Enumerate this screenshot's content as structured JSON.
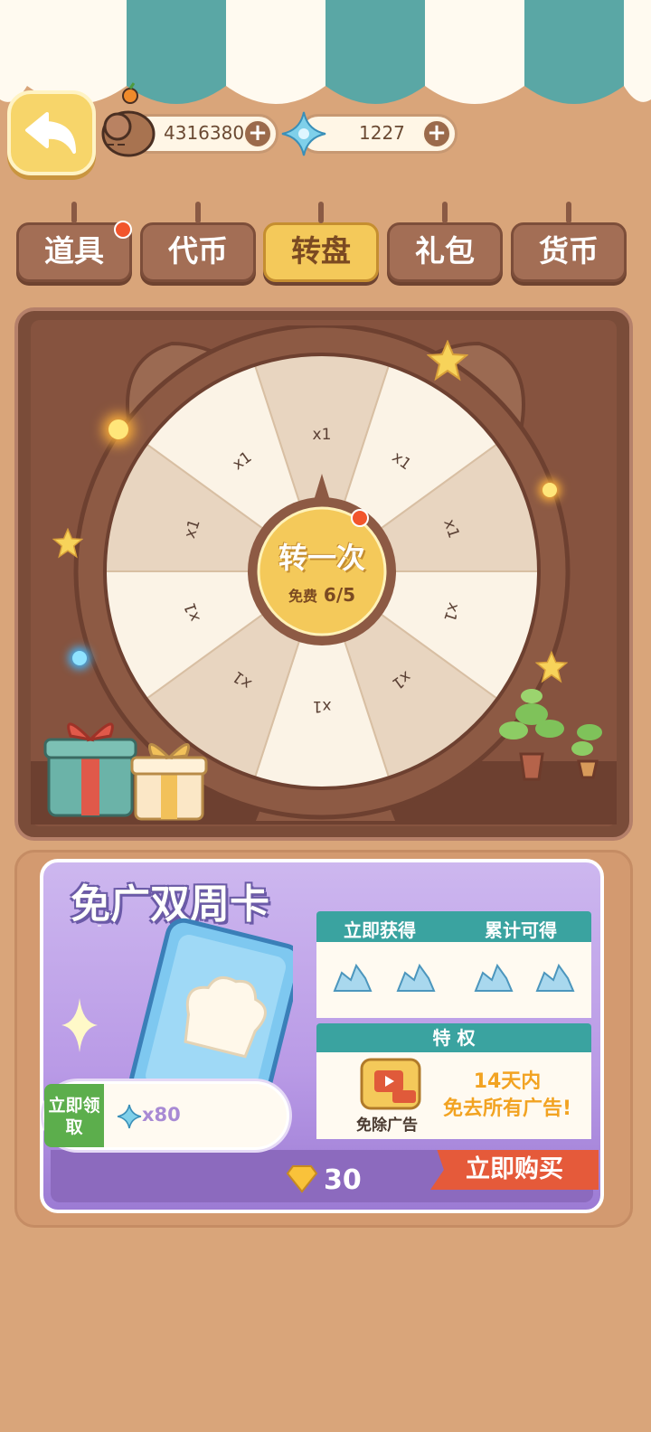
{
  "header": {
    "coins": "4316380",
    "gems": "1227"
  },
  "tabs": [
    {
      "label": "道具"
    },
    {
      "label": "代币"
    },
    {
      "label": "转盘"
    },
    {
      "label": "礼包"
    },
    {
      "label": "货币"
    }
  ],
  "wheel": {
    "segments": [
      "x1",
      "x1",
      "x1",
      "x1",
      "x1",
      "x1",
      "x1",
      "x1",
      "x1",
      "x1"
    ],
    "spin_label": "转一次",
    "free_label": "免费",
    "free_count": "6/5"
  },
  "offer": {
    "title": "免广双周卡",
    "instant_header": "立即获得",
    "total_header": "累计可得",
    "privilege_header": "特 权",
    "remove_ads_label": "免除广告",
    "privilege_text_line1": "14天内",
    "privilege_text_line2": "免去所有广告!",
    "claim_tag": "立即领取",
    "claim_amount": "x80",
    "price": "30",
    "buy_label": "立即购买"
  },
  "colors": {
    "background": "#d9a57a",
    "accent_yellow": "#f4c95a",
    "teal": "#3aa3a0",
    "buy_red": "#e55a3a"
  }
}
